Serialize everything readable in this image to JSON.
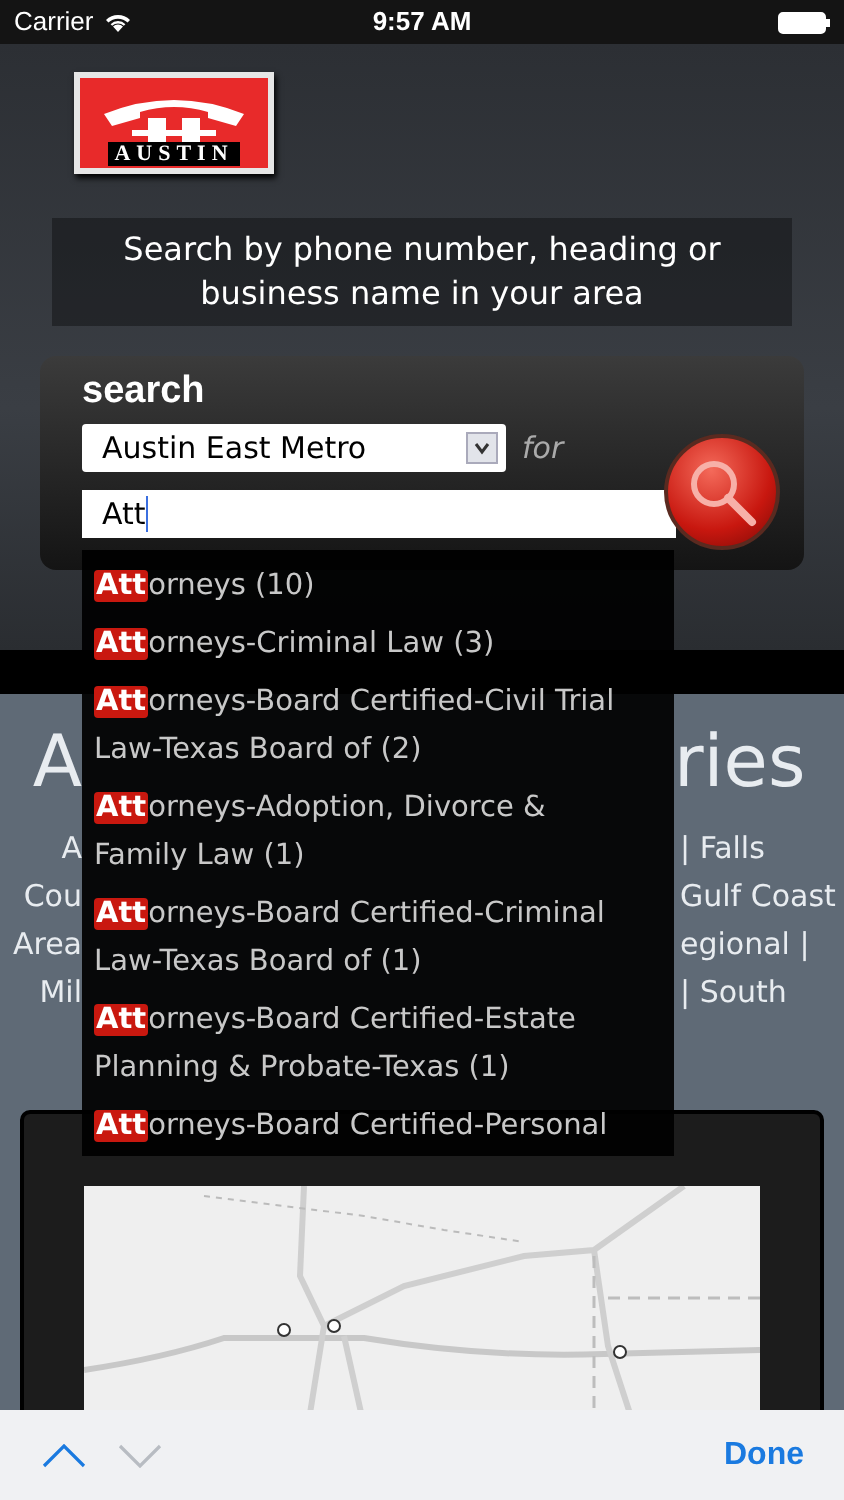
{
  "status_bar": {
    "carrier": "Carrier",
    "time": "9:57 AM"
  },
  "logo": {
    "text": "AUSTIN"
  },
  "tagline": "Search by phone number, heading or business name in your area",
  "search": {
    "title": "search",
    "directory": "Austin East Metro",
    "for_label": "for",
    "query": "Att"
  },
  "suggestions": [
    {
      "match": "Att",
      "rest": "orneys (10)"
    },
    {
      "match": "Att",
      "rest": "orneys-Criminal Law (3)"
    },
    {
      "match": "Att",
      "rest": "orneys-Board Certified-Civil Trial Law-Texas Board of (2)"
    },
    {
      "match": "Att",
      "rest": "orneys-Adoption, Divorce & Family Law (1)"
    },
    {
      "match": "Att",
      "rest": "orneys-Board Certified-Criminal Law-Texas Board of (1)"
    },
    {
      "match": "Att",
      "rest": "orneys-Board Certified-Estate Planning & Probate-Texas (1)"
    },
    {
      "match": "Att",
      "rest": "orneys-Board Certified-Personal"
    }
  ],
  "directories": {
    "heading": {
      "left": "A",
      "right": "ries"
    },
    "lines": [
      {
        "left": "A",
        "right": "| Falls"
      },
      {
        "left": "Cou",
        "right": "Gulf Coast"
      },
      {
        "left": "Area",
        "right": "egional |"
      },
      {
        "left": "Mil",
        "right": "| South"
      }
    ]
  },
  "toolbar": {
    "done": "Done"
  }
}
